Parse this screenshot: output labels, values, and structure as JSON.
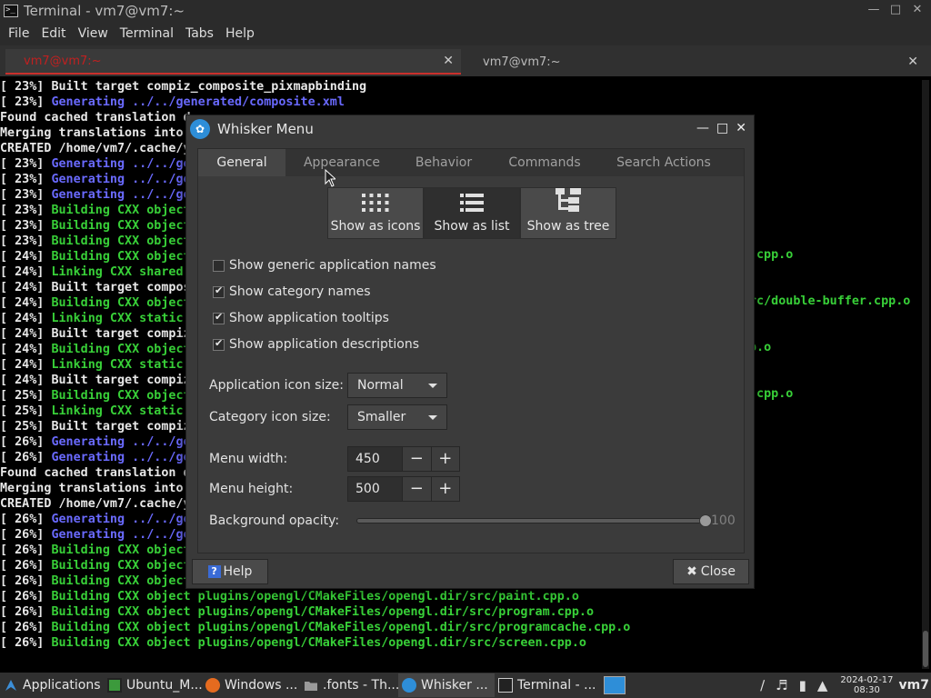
{
  "terminal": {
    "title": "Terminal - vm7@vm7:~",
    "menu": [
      "File",
      "Edit",
      "View",
      "Terminal",
      "Tabs",
      "Help"
    ],
    "tabs": [
      {
        "label": "vm7@vm7:~"
      },
      {
        "label": "vm7@vm7:~"
      }
    ],
    "lines": [
      [
        [
          "[ 23%] ",
          "w"
        ],
        [
          "Built target compiz_composite_pixmapbinding",
          "w"
        ]
      ],
      [
        [
          "[ 23%] ",
          "w"
        ],
        [
          "Generating ../../generated/composite.xml",
          "b"
        ]
      ],
      [
        [
          "Found cached translation d",
          "w"
        ]
      ],
      [
        [
          "Merging translations into",
          "w"
        ]
      ],
      [
        [
          "CREATED /home/vm7/.cache/y",
          "w"
        ]
      ],
      [
        [
          "[ 23%] ",
          "w"
        ],
        [
          "Generating ../../ge",
          "b"
        ]
      ],
      [
        [
          "[ 23%] ",
          "w"
        ],
        [
          "Generating ../../ge",
          "b"
        ]
      ],
      [
        [
          "[ 23%] ",
          "w"
        ],
        [
          "Generating ../../ge",
          "b"
        ]
      ],
      [
        [
          "[ 23%] ",
          "w"
        ],
        [
          "Building CXX object",
          "g"
        ]
      ],
      [
        [
          "[ 23%] ",
          "w"
        ],
        [
          "Building CXX object",
          "g"
        ]
      ],
      [
        [
          "[ 23%] ",
          "w"
        ],
        [
          "Building CXX object",
          "g"
        ]
      ],
      [
        [
          "[ 24%] ",
          "w"
        ],
        [
          "Building CXX object",
          "g"
        ]
      ],
      [
        [
          "[ 24%] ",
          "w"
        ],
        [
          "Linking CXX shared",
          "g"
        ]
      ],
      [
        [
          "[ 24%] ",
          "w"
        ],
        [
          "Built target compos",
          "w"
        ]
      ],
      [
        [
          "[ 24%] ",
          "w"
        ],
        [
          "Building CXX object",
          "g"
        ]
      ],
      [
        [
          "[ 24%] ",
          "w"
        ],
        [
          "Linking CXX static",
          "g"
        ]
      ],
      [
        [
          "[ 24%] ",
          "w"
        ],
        [
          "Built target compiz",
          "w"
        ]
      ],
      [
        [
          "[ 24%] ",
          "w"
        ],
        [
          "Building CXX object",
          "g"
        ]
      ],
      [
        [
          "[ 24%] ",
          "w"
        ],
        [
          "Linking CXX static",
          "g"
        ]
      ],
      [
        [
          "[ 24%] ",
          "w"
        ],
        [
          "Built target compiz",
          "w"
        ]
      ],
      [
        [
          "[ 25%] ",
          "w"
        ],
        [
          "Building CXX object",
          "g"
        ]
      ],
      [
        [
          "[ 25%] ",
          "w"
        ],
        [
          "Linking CXX static",
          "g"
        ]
      ],
      [
        [
          "[ 25%] ",
          "w"
        ],
        [
          "Built target compiz",
          "w"
        ]
      ],
      [
        [
          "[ 26%] ",
          "w"
        ],
        [
          "Generating ../../ge",
          "b"
        ]
      ],
      [
        [
          "[ 26%] ",
          "w"
        ],
        [
          "Generating ../../ge",
          "b"
        ]
      ],
      [
        [
          "Found cached translation d",
          "w"
        ]
      ],
      [
        [
          "Merging translations into",
          "w"
        ]
      ],
      [
        [
          "CREATED /home/vm7/.cache/y",
          "w"
        ]
      ],
      [
        [
          "[ 26%] ",
          "w"
        ],
        [
          "Generating ../../ge",
          "b"
        ]
      ],
      [
        [
          "[ 26%] ",
          "w"
        ],
        [
          "Generating ../../ge",
          "b"
        ]
      ],
      [
        [
          "[ 26%] ",
          "w"
        ],
        [
          "Building CXX object",
          "g"
        ]
      ],
      [
        [
          "[ 26%] ",
          "w"
        ],
        [
          "Building CXX object",
          "g"
        ]
      ],
      [
        [
          "[ 26%] ",
          "w"
        ],
        [
          "Building CXX object",
          "g"
        ]
      ],
      [
        [
          "[ 26%] ",
          "w"
        ],
        [
          "Building CXX object plugins/opengl/CMakeFiles/opengl.dir/src/paint.cpp.o",
          "g"
        ]
      ],
      [
        [
          "[ 26%] ",
          "w"
        ],
        [
          "Building CXX object plugins/opengl/CMakeFiles/opengl.dir/src/program.cpp.o",
          "g"
        ]
      ],
      [
        [
          "[ 26%] ",
          "w"
        ],
        [
          "Building CXX object plugins/opengl/CMakeFiles/opengl.dir/src/programcache.cpp.o",
          "g"
        ]
      ],
      [
        [
          "[ 26%] ",
          "w"
        ],
        [
          "Building CXX object plugins/opengl/CMakeFiles/opengl.dir/src/screen.cpp.o",
          "g"
        ]
      ]
    ],
    "right_fragments": [
      {
        "text": "cpp.o"
      },
      {
        "text": "rc/double-buffer.cpp.o"
      },
      {
        "text": "p.o"
      },
      {
        "text": ".cpp.o"
      }
    ]
  },
  "dialog": {
    "title": "Whisker Menu",
    "tabs": [
      {
        "label": "General",
        "active": true
      },
      {
        "label": "Appearance",
        "active": false
      },
      {
        "label": "Behavior",
        "active": false
      },
      {
        "label": "Commands",
        "active": false
      },
      {
        "label": "Search Actions",
        "active": false
      }
    ],
    "view_buttons": [
      {
        "label": "Show as icons",
        "icon": "grid-icon"
      },
      {
        "label": "Show as list",
        "icon": "list-icon",
        "active": true
      },
      {
        "label": "Show as tree",
        "icon": "tree-icon"
      }
    ],
    "checkboxes": [
      {
        "label": "Show generic application names",
        "checked": false
      },
      {
        "label": "Show category names",
        "checked": true
      },
      {
        "label": "Show application tooltips",
        "checked": true
      },
      {
        "label": "Show application descriptions",
        "checked": true
      }
    ],
    "app_icon_size_label": "Application icon size:",
    "app_icon_size_value": "Normal",
    "cat_icon_size_label": "Category icon size:",
    "cat_icon_size_value": "Smaller",
    "menu_width_label": "Menu width:",
    "menu_width_value": "450",
    "menu_height_label": "Menu height:",
    "menu_height_value": "500",
    "opacity_label": "Background opacity:",
    "opacity_value": "100",
    "opacity_fraction": 1.0,
    "help_label": "Help",
    "close_label": "Close"
  },
  "taskbar": {
    "apps_label": "Applications",
    "items": [
      {
        "label": "Ubuntu_M...",
        "icon": "vm-icon",
        "color": "#3c9a3c"
      },
      {
        "label": "Windows ...",
        "icon": "firefox-icon",
        "color": "#e56b1f"
      },
      {
        "label": ".fonts - Th...",
        "icon": "folder-icon",
        "color": "#9a9a9a"
      },
      {
        "label": "Whisker ...",
        "icon": "whisker-icon",
        "color": "#2e8ed8",
        "active": true
      },
      {
        "label": "Terminal - ...",
        "icon": "terminal-icon",
        "color": "#cccccc"
      }
    ],
    "date": "2024-02-17",
    "time": "08:30",
    "user": "vm7"
  }
}
